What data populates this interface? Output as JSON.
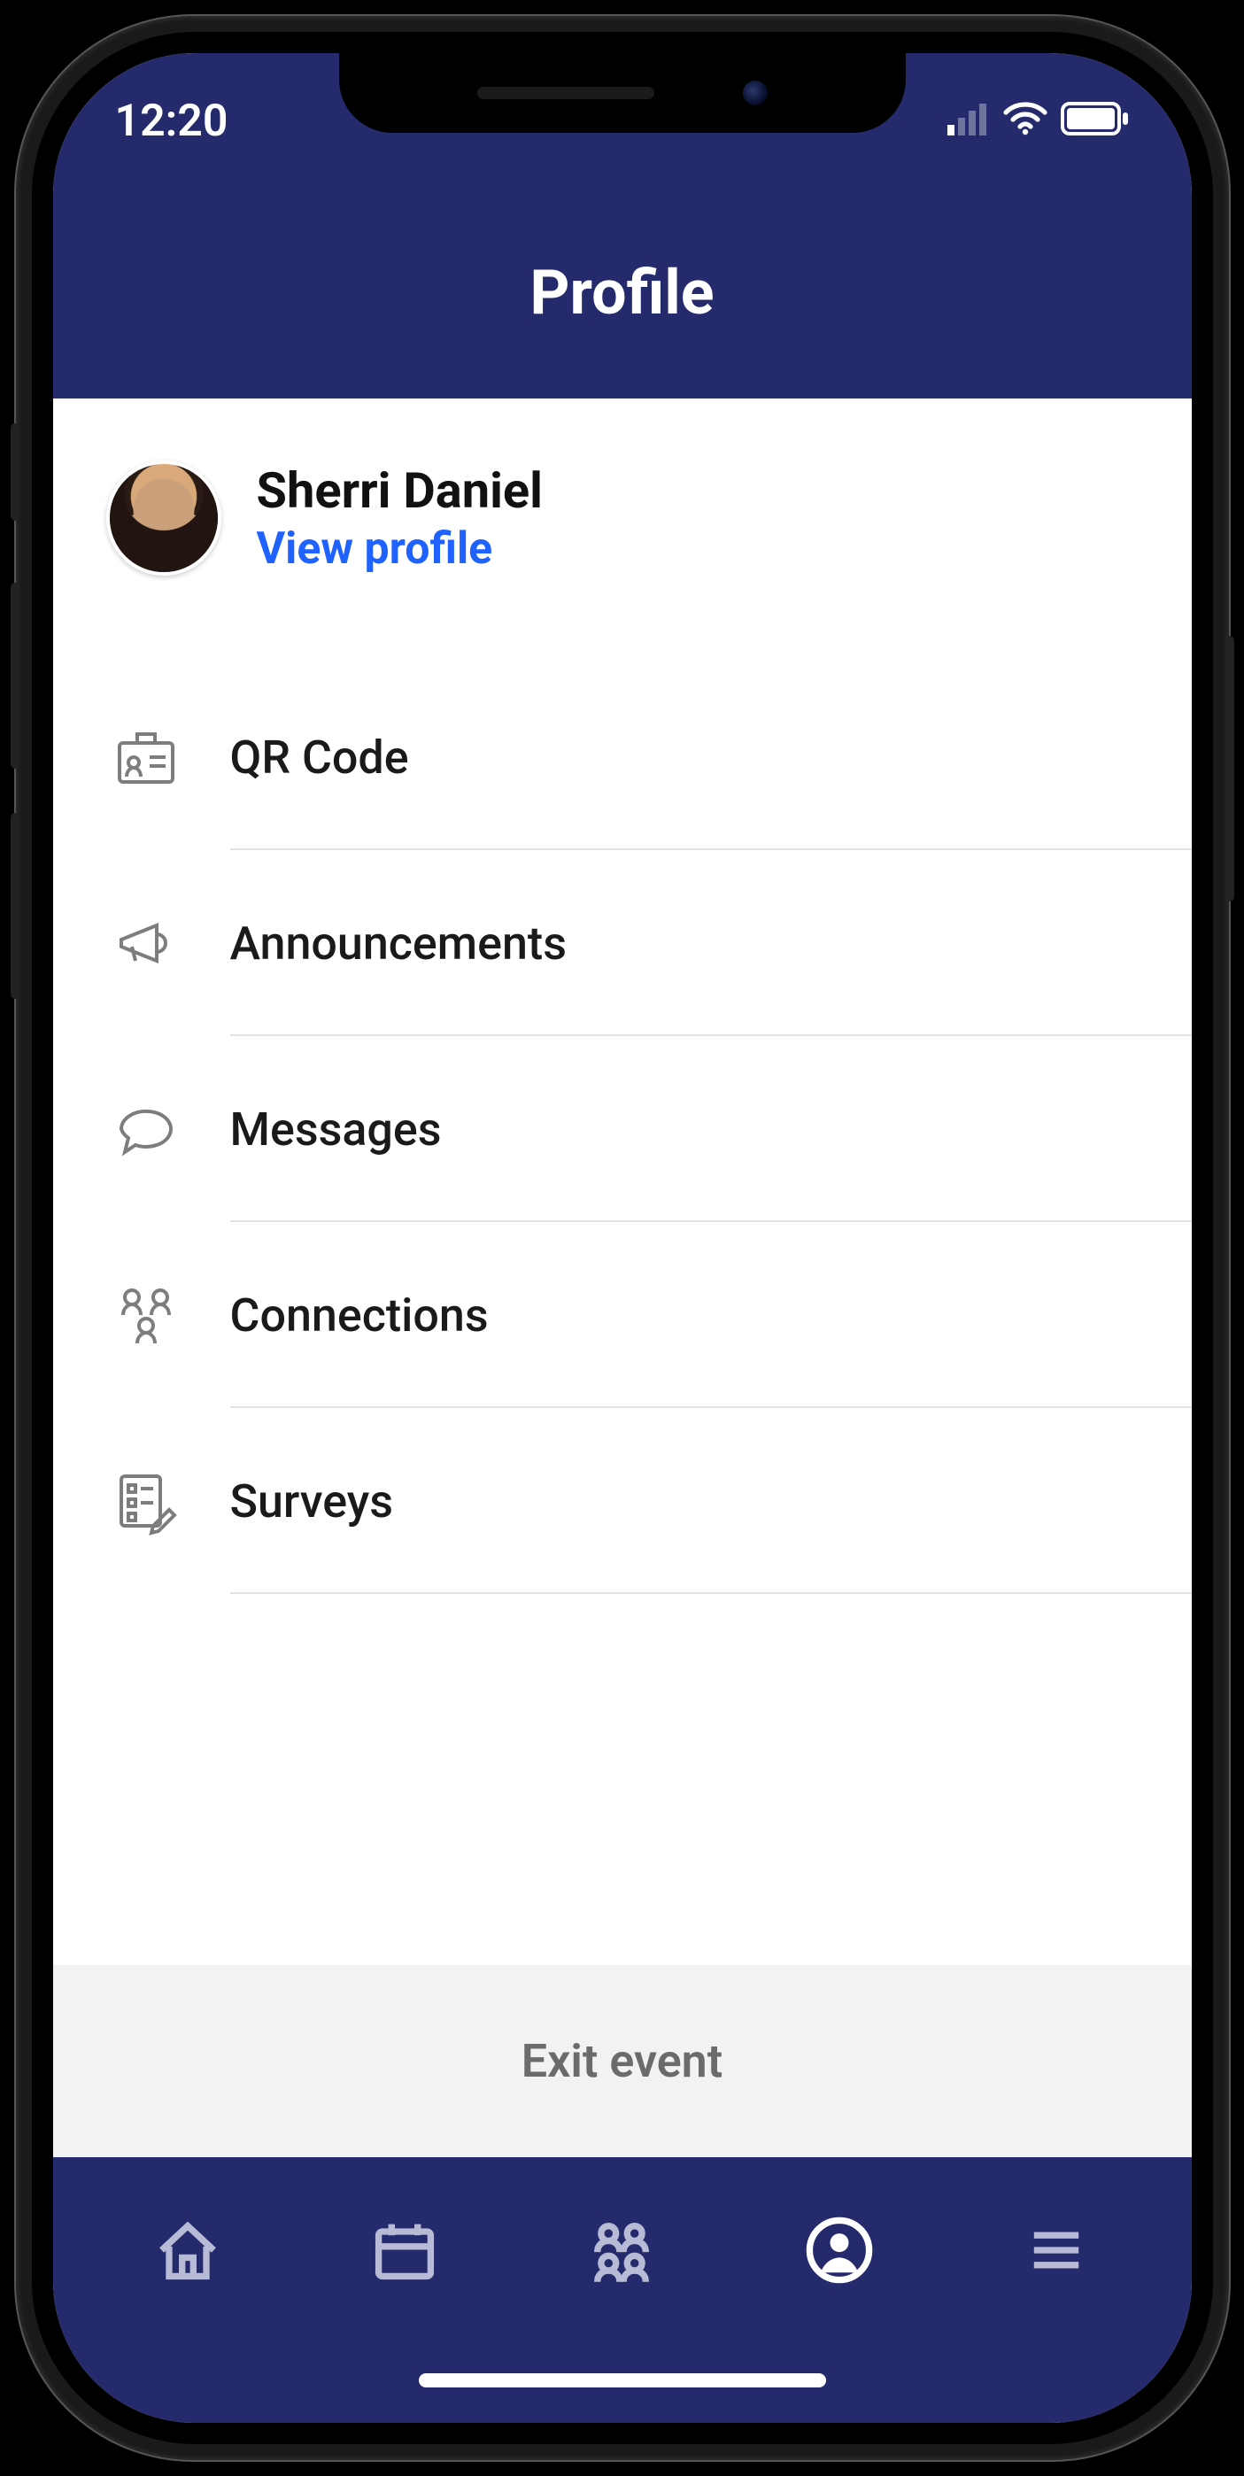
{
  "status": {
    "time": "12:20"
  },
  "header": {
    "title": "Profile"
  },
  "profile": {
    "name": "Sherri Daniel",
    "view_link": "View profile"
  },
  "menu": {
    "items": [
      {
        "icon": "badge-icon",
        "label": "QR Code"
      },
      {
        "icon": "megaphone-icon",
        "label": "Announcements"
      },
      {
        "icon": "chat-icon",
        "label": "Messages"
      },
      {
        "icon": "people-icon",
        "label": "Connections"
      },
      {
        "icon": "survey-icon",
        "label": "Surveys"
      }
    ]
  },
  "footer": {
    "exit_label": "Exit event"
  },
  "tabs": [
    {
      "name": "home-tab",
      "icon": "home-icon",
      "active": false
    },
    {
      "name": "calendar-tab",
      "icon": "calendar-icon",
      "active": false
    },
    {
      "name": "attendees-tab",
      "icon": "attendees-icon",
      "active": false
    },
    {
      "name": "profile-tab",
      "icon": "profile-circle-icon",
      "active": true
    },
    {
      "name": "menu-tab",
      "icon": "hamburger-icon",
      "active": false
    }
  ],
  "colors": {
    "brand": "#242a6b",
    "link": "#1f62ff",
    "muted": "#7d7d7d"
  }
}
